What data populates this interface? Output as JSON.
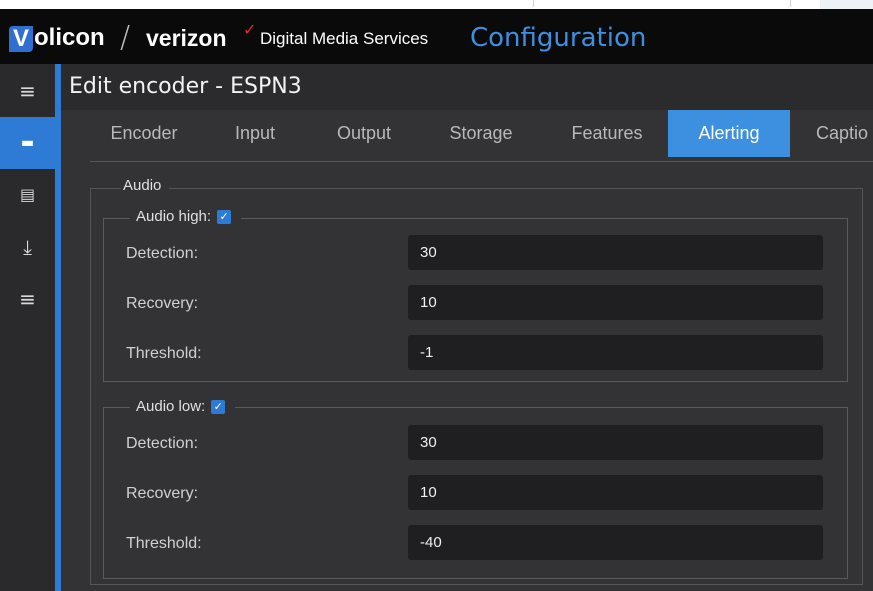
{
  "header": {
    "logo_v": "V",
    "logo_rest": "olicon",
    "logo_slash": "/",
    "logo_verizon": "verizon",
    "logo_check": "✓",
    "subtitle": "Digital Media Services",
    "section": "Configuration"
  },
  "sidebar": {
    "items": [
      {
        "icon": "menu-icon",
        "glyph": "≡",
        "active": false
      },
      {
        "icon": "encoder-icon",
        "glyph": "▬",
        "active": true
      },
      {
        "icon": "id-card-icon",
        "glyph": "▤",
        "active": false
      },
      {
        "icon": "download-icon",
        "glyph": "⤓",
        "active": false
      },
      {
        "icon": "list-icon",
        "glyph": "≡",
        "active": false
      }
    ],
    "collapse_glyph": "❯"
  },
  "page": {
    "title": "Edit encoder - ESPN3"
  },
  "tabs": [
    {
      "label": "Encoder",
      "active": false
    },
    {
      "label": "Input",
      "active": false
    },
    {
      "label": "Output",
      "active": false
    },
    {
      "label": "Storage",
      "active": false
    },
    {
      "label": "Features",
      "active": false
    },
    {
      "label": "Alerting",
      "active": true
    },
    {
      "label": "Captio",
      "active": false
    }
  ],
  "audio": {
    "legend": "Audio",
    "high": {
      "legend": "Audio high:",
      "checked": true,
      "check_glyph": "✓",
      "detection_label": "Detection:",
      "detection_value": "30",
      "recovery_label": "Recovery:",
      "recovery_value": "10",
      "threshold_label": "Threshold:",
      "threshold_value": "-1"
    },
    "low": {
      "legend": "Audio low:",
      "checked": true,
      "check_glyph": "✓",
      "detection_label": "Detection:",
      "detection_value": "30",
      "recovery_label": "Recovery:",
      "recovery_value": "10",
      "threshold_label": "Threshold:",
      "threshold_value": "-40"
    }
  },
  "colors": {
    "accent": "#2e7bd6",
    "tab_active": "#3d8fe0",
    "header_bg": "#0a0a0a",
    "panel_bg": "#333336",
    "input_bg": "#1f1f22",
    "brand_red": "#e0282e"
  }
}
